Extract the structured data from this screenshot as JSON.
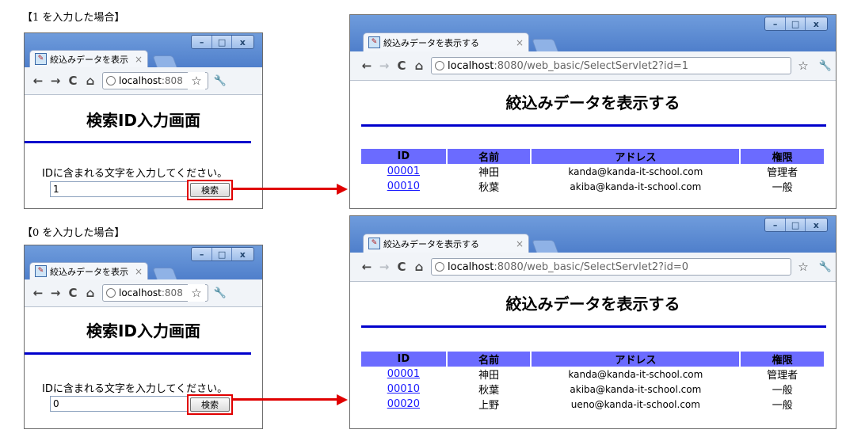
{
  "panels": [
    {
      "caption": "【1 を入力した場合】",
      "input_browser": {
        "tab_title": "絞込みデータを表示",
        "url_host": "localhost",
        "url_rest": ":808",
        "page_title": "検索ID入力画面",
        "prompt": "IDに含まれる文字を入力してください。",
        "input_value": "1",
        "search_label": "検索"
      },
      "result_browser": {
        "tab_title": "絞込みデータを表示する",
        "url_host": "localhost",
        "url_rest": ":8080/web_basic/SelectServlet2?id=1",
        "page_title": "絞込みデータを表示する",
        "columns": [
          "ID",
          "名前",
          "アドレス",
          "権限"
        ],
        "rows": [
          {
            "id": "00001",
            "name": "神田",
            "address": "kanda@kanda-it-school.com",
            "role": "管理者"
          },
          {
            "id": "00010",
            "name": "秋葉",
            "address": "akiba@kanda-it-school.com",
            "role": "一般"
          }
        ]
      }
    },
    {
      "caption": "【0 を入力した場合】",
      "input_browser": {
        "tab_title": "絞込みデータを表示",
        "url_host": "localhost",
        "url_rest": ":808",
        "page_title": "検索ID入力画面",
        "prompt": "IDに含まれる文字を入力してください。",
        "input_value": "0",
        "search_label": "検索"
      },
      "result_browser": {
        "tab_title": "絞込みデータを表示する",
        "url_host": "localhost",
        "url_rest": ":8080/web_basic/SelectServlet2?id=0",
        "page_title": "絞込みデータを表示する",
        "columns": [
          "ID",
          "名前",
          "アドレス",
          "権限"
        ],
        "rows": [
          {
            "id": "00001",
            "name": "神田",
            "address": "kanda@kanda-it-school.com",
            "role": "管理者"
          },
          {
            "id": "00010",
            "name": "秋葉",
            "address": "akiba@kanda-it-school.com",
            "role": "一般"
          },
          {
            "id": "00020",
            "name": "上野",
            "address": "ueno@kanda-it-school.com",
            "role": "一般"
          }
        ]
      }
    }
  ],
  "window_controls": {
    "minimize": "–",
    "maximize": "□",
    "close": "x"
  },
  "tab_close": "×",
  "nav_icons": {
    "back": "←",
    "forward": "→",
    "reload": "C",
    "home": "⌂",
    "star": "☆",
    "wrench": "🔧"
  },
  "colors": {
    "accent_rule": "#0000cc",
    "table_header": "#6b6bff",
    "highlight": "#e00000",
    "link": "#1a1aff"
  }
}
